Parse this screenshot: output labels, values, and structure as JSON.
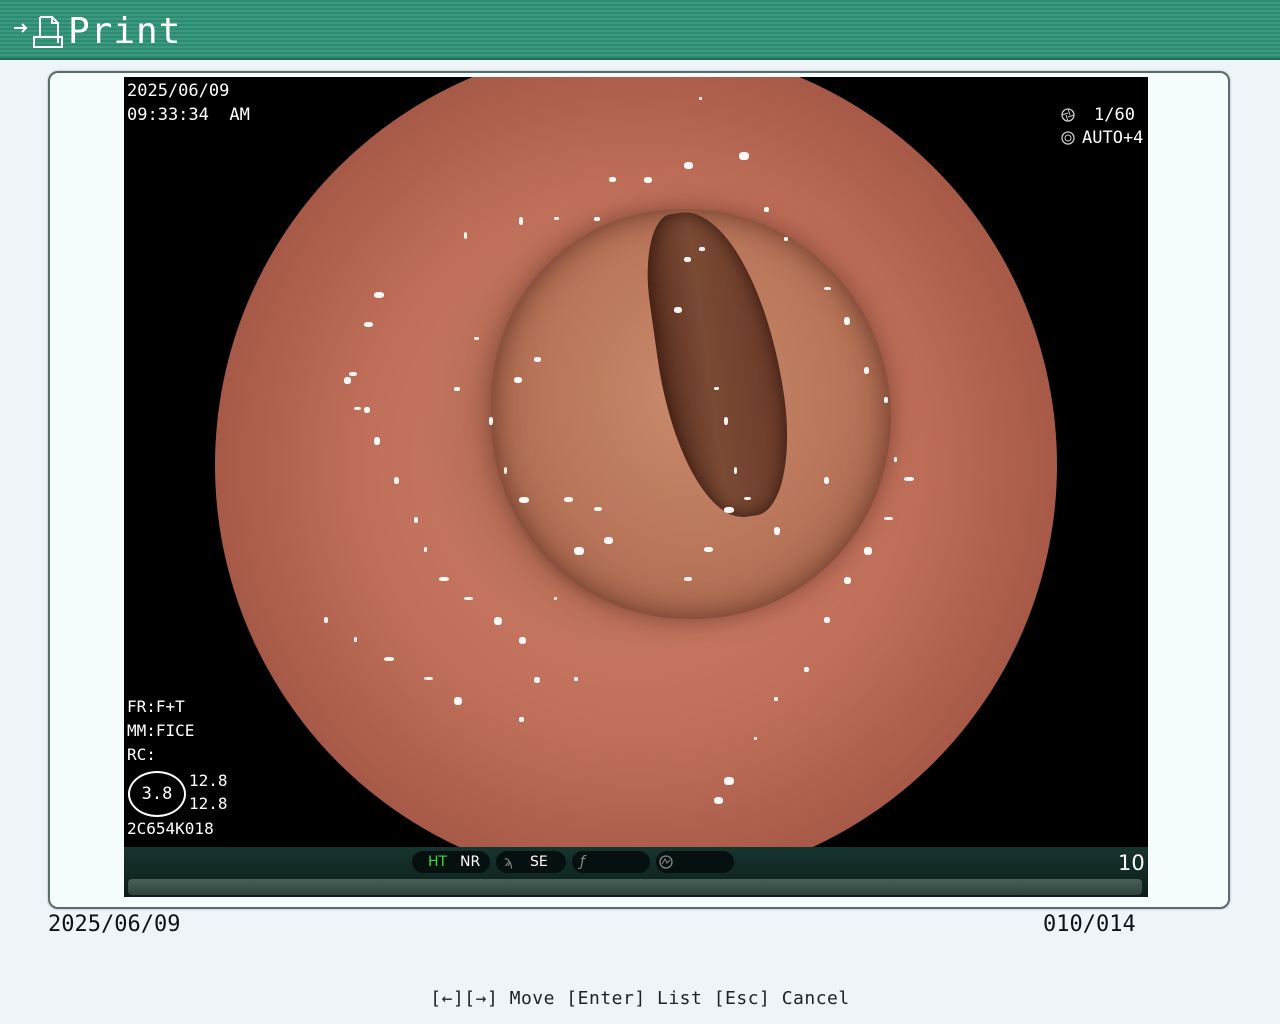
{
  "window": {
    "title": "Print",
    "colors": {
      "title_bar": "#2e8a70",
      "panel": "#f4fcfc",
      "background": "#eef4f8"
    }
  },
  "image_overlay": {
    "date": "2025/06/09",
    "time": "09:33:34  AM",
    "shutter": "1/60",
    "iris": "AUTO+4",
    "fr": "FR:F+T",
    "mm": "MM:FICE",
    "rc": "RC:",
    "circle_value": "3.8",
    "value_top": "12.8",
    "value_bottom": "12.8",
    "scope_id": "2C654K018",
    "ht": "HT",
    "nr": "NR",
    "se": "SE",
    "frame_number": "10"
  },
  "footer": {
    "date": "2025/06/09",
    "counter": "010/014"
  },
  "help": {
    "text": "[←][→] Move  [Enter] List  [Esc] Cancel"
  }
}
